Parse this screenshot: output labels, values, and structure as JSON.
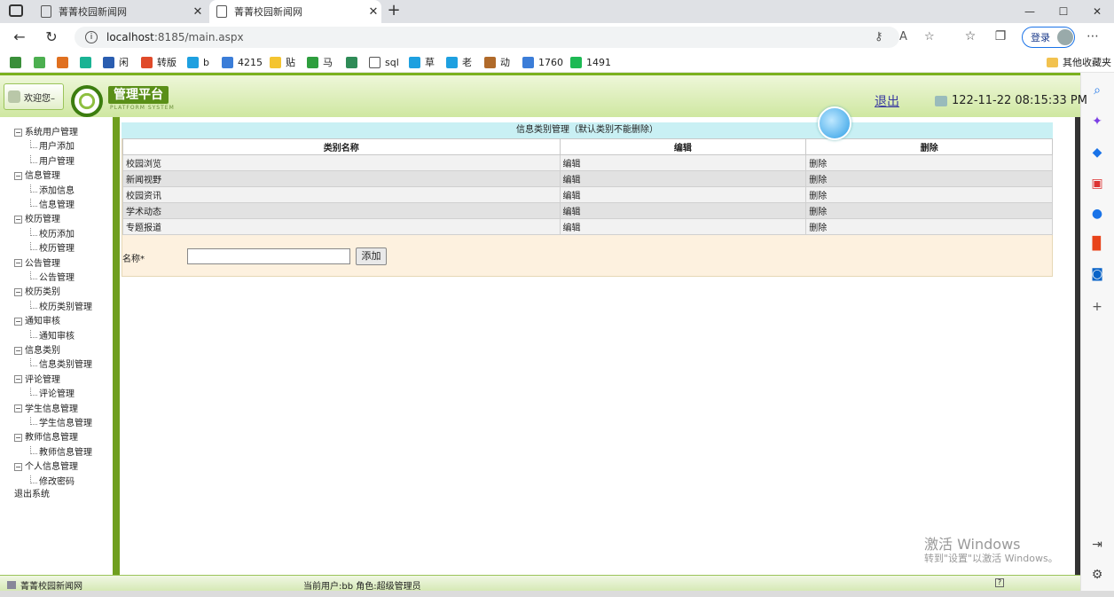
{
  "browser": {
    "tabs": [
      {
        "title": "菁菁校园新闻网",
        "close": "✕"
      },
      {
        "title": "菁菁校园新闻网",
        "close": "✕"
      }
    ],
    "new_tab": "+",
    "window_controls": [
      "—",
      "☐",
      "✕"
    ],
    "url": {
      "host": "localhost",
      "path": ":8185/main.aspx"
    },
    "login_label": "登录",
    "bookmarks": [
      {
        "label": "",
        "color": "#3a8f3a"
      },
      {
        "label": "",
        "color": "#4caf50"
      },
      {
        "label": "",
        "color": "#e07020"
      },
      {
        "label": "",
        "color": "#1ab394"
      },
      {
        "label": "闲",
        "color": "#2a5db0"
      },
      {
        "label": "转版",
        "color": "#e04a2a"
      },
      {
        "label": "b",
        "color": "#1ea0e0"
      },
      {
        "label": "4215",
        "color": "#3b7dd8"
      },
      {
        "label": "贴",
        "color": "#f4c430"
      },
      {
        "label": "马",
        "color": "#2e9e3e"
      },
      {
        "label": "",
        "color": "#2e8b57"
      },
      {
        "label": "sql",
        "color": "#ffffff"
      },
      {
        "label": "草",
        "color": "#1ea0e0"
      },
      {
        "label": "老",
        "color": "#1ea0e0"
      },
      {
        "label": "动",
        "color": "#b06a2a"
      },
      {
        "label": "1760",
        "color": "#3b7dd8"
      },
      {
        "label": "1491",
        "color": "#1db954"
      }
    ],
    "other_bookmarks": "其他收藏夹"
  },
  "header": {
    "welcome": "欢迎您–",
    "brand": "管理平台",
    "brand_sub": "PLATFORM SYSTEM",
    "logout": "退出",
    "datetime": "122-11-22 08:15:33 PM"
  },
  "nav": {
    "groups": [
      {
        "label": "系统用户管理",
        "items": [
          "用户添加",
          "用户管理"
        ]
      },
      {
        "label": "信息管理",
        "items": [
          "添加信息",
          "信息管理"
        ]
      },
      {
        "label": "校历管理",
        "items": [
          "校历添加",
          "校历管理"
        ]
      },
      {
        "label": "公告管理",
        "items": [
          "公告管理"
        ]
      },
      {
        "label": "校历类别",
        "items": [
          "校历类别管理"
        ]
      },
      {
        "label": "通知审核",
        "items": [
          "通知审核"
        ]
      },
      {
        "label": "信息类别",
        "items": [
          "信息类别管理"
        ]
      },
      {
        "label": "评论管理",
        "items": [
          "评论管理"
        ]
      },
      {
        "label": "学生信息管理",
        "items": [
          "学生信息管理"
        ]
      },
      {
        "label": "教师信息管理",
        "items": [
          "教师信息管理"
        ]
      },
      {
        "label": "个人信息管理",
        "items": [
          "修改密码"
        ]
      }
    ],
    "exit": "退出系统"
  },
  "main": {
    "title": "信息类别管理（默认类别不能删除）",
    "columns": [
      "类别名称",
      "编辑",
      "删除"
    ],
    "rows": [
      {
        "name": "校园浏览",
        "edit": "编辑",
        "delete": "删除"
      },
      {
        "name": "新闻视野",
        "edit": "编辑",
        "delete": "删除"
      },
      {
        "name": "校园资讯",
        "edit": "编辑",
        "delete": "删除"
      },
      {
        "name": "学术动态",
        "edit": "编辑",
        "delete": "删除"
      },
      {
        "name": "专题报道",
        "edit": "编辑",
        "delete": "删除"
      }
    ],
    "form": {
      "name_label": "名称*",
      "name_value": "",
      "add_button": "添加"
    }
  },
  "status": {
    "site": "菁菁校园新闻网",
    "user": "当前用户:bb 角色:超级管理员",
    "help": "?"
  },
  "watermark": {
    "line1": "激活 Windows",
    "line2": "转到\"设置\"以激活 Windows。"
  }
}
